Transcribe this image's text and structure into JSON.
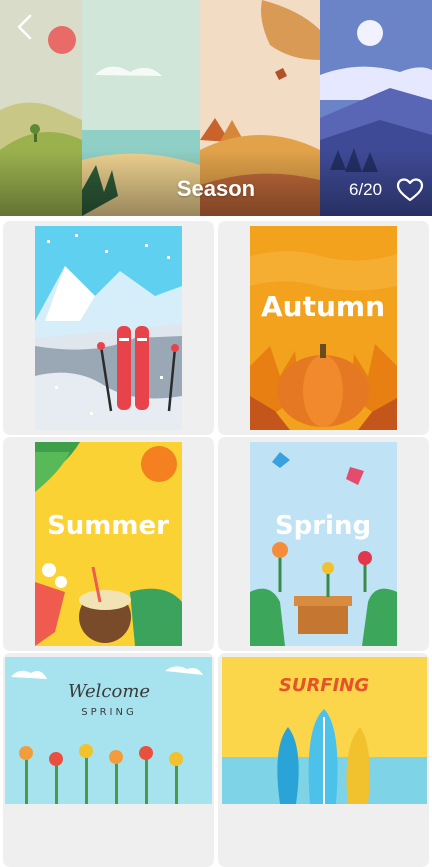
{
  "header": {
    "title": "Season",
    "progress": "6/20"
  },
  "icons": {
    "back": "chevron-left-icon",
    "favorite": "heart-outline-icon"
  },
  "cards": [
    {
      "name": "winter-skis"
    },
    {
      "name": "autumn-pumpkin",
      "text": "Autumn"
    },
    {
      "name": "summer-coconut",
      "text": "Summer"
    },
    {
      "name": "spring-flowers",
      "text": "Spring"
    },
    {
      "name": "welcome-spring",
      "text": "Welcome",
      "subtext": "SPRING"
    },
    {
      "name": "surfing",
      "text": "SURFING"
    }
  ]
}
